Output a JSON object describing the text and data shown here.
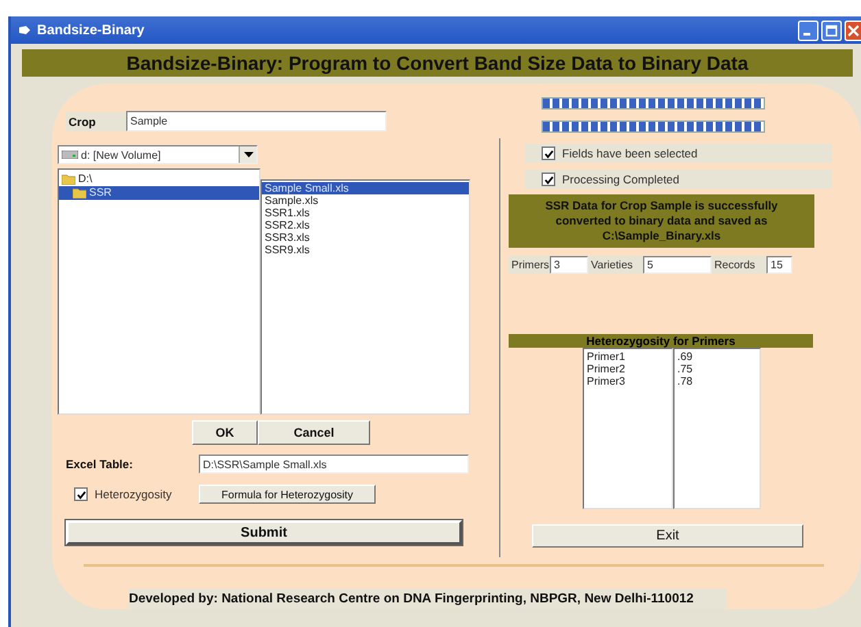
{
  "window": {
    "title": "Bandsize-Binary"
  },
  "header": "Bandsize-Binary: Program to Convert Band Size Data to Binary Data",
  "crop": {
    "label": "Crop",
    "value": "Sample"
  },
  "drive": {
    "value": "d: [New Volume]"
  },
  "folders": [
    {
      "label": "D:\\",
      "selected": false,
      "children": [
        {
          "label": "SSR",
          "selected": true
        }
      ]
    }
  ],
  "files": [
    {
      "label": "Sample Small.xls",
      "selected": true
    },
    {
      "label": "Sample.xls",
      "selected": false
    },
    {
      "label": "SSR1.xls",
      "selected": false
    },
    {
      "label": "SSR2.xls",
      "selected": false
    },
    {
      "label": "SSR3.xls",
      "selected": false
    },
    {
      "label": "SSR9.xls",
      "selected": false
    }
  ],
  "dialog_buttons": [
    "OK",
    "Cancel"
  ],
  "excel_table": {
    "label": "Excel Table:",
    "value": "D:\\SSR\\Sample Small.xls"
  },
  "heterozygosity": {
    "label": "Heterozygosity",
    "checked": true
  },
  "formula_button": "Formula for Heterozygosity",
  "submit": "Submit",
  "progress": [
    {
      "level": 1
    },
    {
      "level": 1
    }
  ],
  "status_checks": [
    {
      "label": "Fields have been selected",
      "checked": true
    },
    {
      "label": "Processing Completed",
      "checked": true
    }
  ],
  "message": "SSR Data for Crop Sample is successfully converted to binary data and saved as C:\\Sample_Binary.xls",
  "stats": [
    {
      "label": "Primers",
      "value": "3"
    },
    {
      "label": "Varieties",
      "value": "5"
    },
    {
      "label": "Records",
      "value": "15"
    }
  ],
  "primer_table": {
    "title": "Heterozygosity for Primers",
    "rows": [
      {
        "primer": "Primer1",
        "value": ".69"
      },
      {
        "primer": "Primer2",
        "value": ".75"
      },
      {
        "primer": "Primer3",
        "value": ".78"
      }
    ]
  },
  "exit": "Exit",
  "footer": "Developed by: National Research Centre on DNA Fingerprinting, NBPGR, New Delhi-110012"
}
